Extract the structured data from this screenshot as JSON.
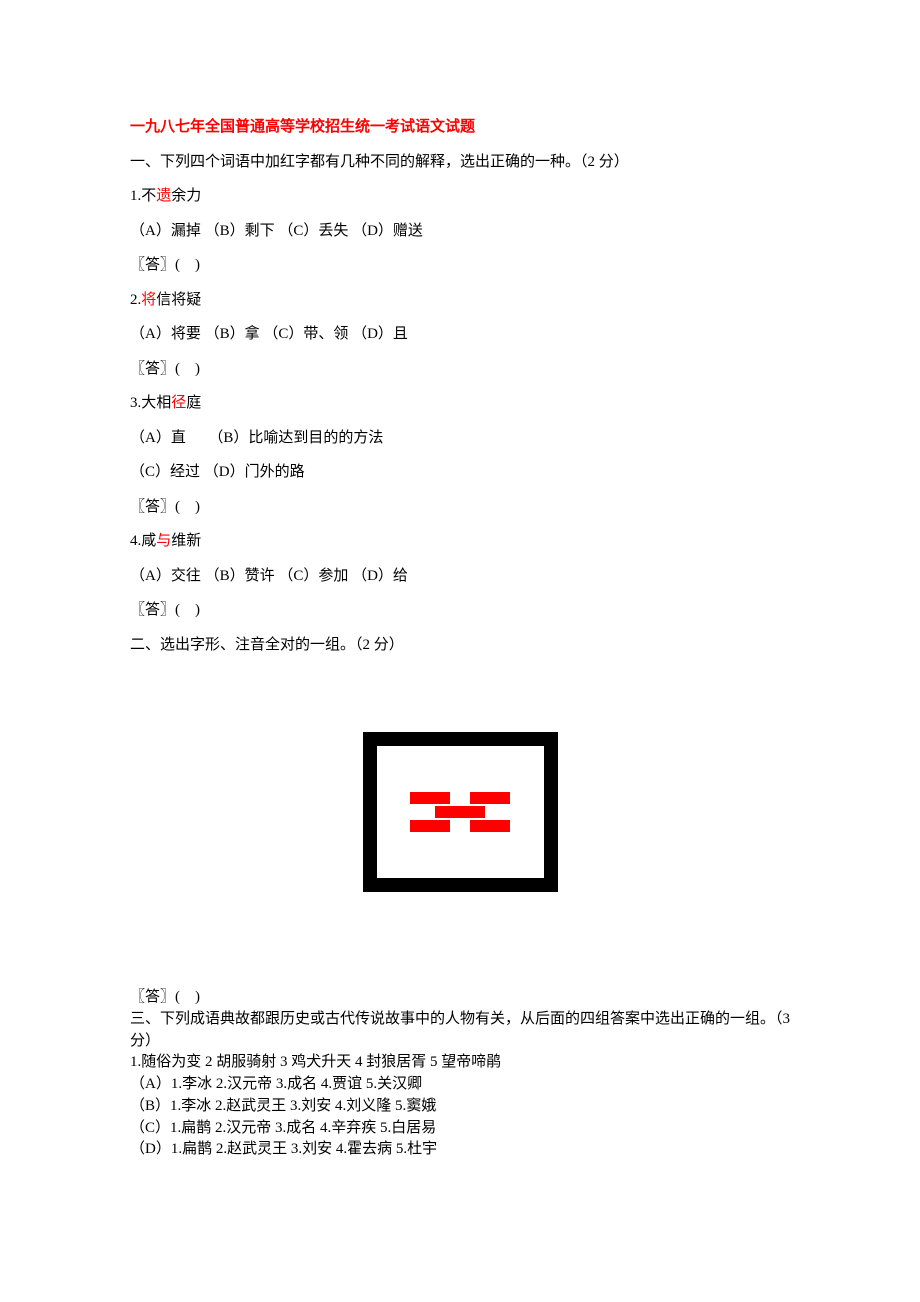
{
  "title": "一九八七年全国普通高等学校招生统一考试语文试题",
  "section1_intro": "一、下列四个词语中加红字都有几种不同的解释，选出正确的一种。（2 分）",
  "q1": {
    "num": "1.",
    "pre": "不",
    "hl": "遗",
    "post": "余力",
    "options": "（A）漏掉 （B）剩下 （C）丢失 （D）赠送",
    "ans": "〖答〗(　)"
  },
  "q2": {
    "num": "2.",
    "hl": "将",
    "post": "信将疑",
    "options": "（A）将要 （B）拿 （C）带、领 （D）且",
    "ans": "〖答〗(　)"
  },
  "q3": {
    "num": "3.",
    "pre": "大相",
    "hl": "径",
    "post": "庭",
    "opt_line1": "（A）直　　（B）比喻达到目的的方法",
    "opt_line2": "（C）经过 （D）门外的路",
    "ans": "〖答〗(　)"
  },
  "q4": {
    "num": "4.",
    "pre": "咸",
    "hl": "与",
    "post": "维新",
    "options": "（A）交往 （B）赞许 （C）参加 （D）给",
    "ans": "〖答〗(　)"
  },
  "section2_intro": "二、选出字形、注音全对的一组。（2 分）",
  "section2_ans": "〖答〗(　)",
  "section3": {
    "intro": "三、下列成语典故都跟历史或古代传说故事中的人物有关，从后面的四组答案中选出正确的一组。（3 分）",
    "items": "1.随俗为变 2 胡服骑射 3 鸡犬升天 4 封狼居胥 5 望帝啼鹃",
    "optA": "（A）1.李冰 2.汉元帝 3.成名 4.贾谊 5.关汉卿",
    "optB": "（B）1.李冰 2.赵武灵王 3.刘安 4.刘义隆 5.窦娥",
    "optC": "（C）1.扁鹊 2.汉元帝 3.成名 4.辛弃疾 5.白居易",
    "optD": "（D）1.扁鹊 2.赵武灵王 3.刘安 4.霍去病 5.杜宇"
  }
}
